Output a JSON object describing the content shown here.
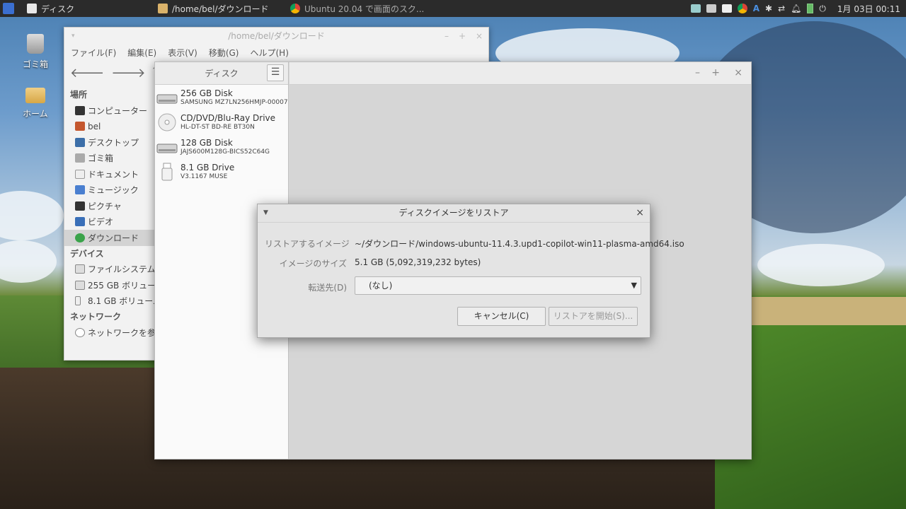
{
  "panel": {
    "tasks": [
      {
        "label": "ディスク",
        "icon": "disks-icon"
      },
      {
        "label": "/home/bel/ダウンロード",
        "icon": "folder-icon"
      },
      {
        "label": "Ubuntu 20.04 で画面のスク...",
        "icon": "chrome-icon"
      }
    ],
    "clock": "1月 03日 00:11"
  },
  "desktop": {
    "trash_label": "ゴミ箱",
    "home_label": "ホーム"
  },
  "file_manager": {
    "title": "/home/bel/ダウンロード",
    "menu": [
      "ファイル(F)",
      "編集(E)",
      "表示(V)",
      "移動(G)",
      "ヘルプ(H)"
    ],
    "places_header": "場所",
    "places": [
      "コンピューター",
      "bel",
      "デスクトップ",
      "ゴミ箱",
      "ドキュメント",
      "ミュージック",
      "ピクチャ",
      "ビデオ",
      "ダウンロード"
    ],
    "devices_header": "デバイス",
    "devices": [
      "ファイルシステム",
      "255 GB ボリューム",
      "8.1 GB ボリューム"
    ],
    "network_header": "ネットワーク",
    "network": [
      "ネットワークを参照"
    ]
  },
  "disks": {
    "header": "ディスク",
    "items": [
      {
        "name": "256 GB Disk",
        "sub": "SAMSUNG MZ7LN256HMJP-00007",
        "icon": "hdd-icon"
      },
      {
        "name": "CD/DVD/Blu-Ray Drive",
        "sub": "HL-DT-ST BD-RE BT30N",
        "icon": "optical-icon"
      },
      {
        "name": "128 GB Disk",
        "sub": "JAJS600M128G-BICS52C64G",
        "icon": "hdd-icon"
      },
      {
        "name": "8.1 GB Drive",
        "sub": "V3.1167 MUSE",
        "icon": "usb-icon"
      }
    ]
  },
  "dialog": {
    "title": "ディスクイメージをリストア",
    "image_label": "リストアするイメージ",
    "image_value": "~/ダウンロード/windows-ubuntu-11.4.3.upd1-copilot-win11-plasma-amd64.iso",
    "size_label": "イメージのサイズ",
    "size_value": "5.1 GB (5,092,319,232 bytes)",
    "dest_label": "転送先(D)",
    "dest_value": "(なし)",
    "cancel": "キャンセル(C)",
    "start": "リストアを開始(S)..."
  }
}
